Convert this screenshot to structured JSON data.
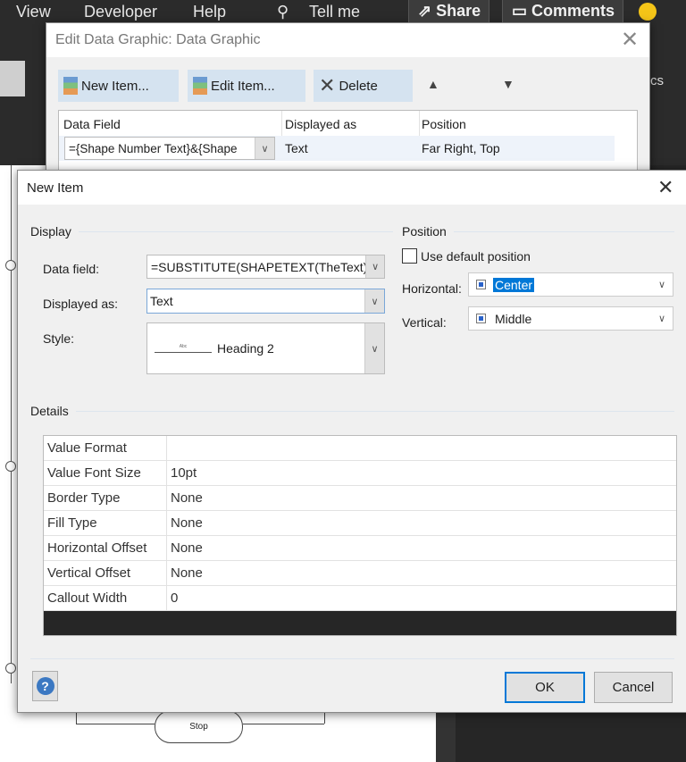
{
  "app_menu": {
    "items": [
      "View",
      "Developer",
      "Help"
    ],
    "tell_me": "Tell me",
    "share": "Share",
    "comments": "Comments",
    "ribbon_fragment": "cs"
  },
  "edit_dialog": {
    "title": "Edit Data Graphic: Data Graphic",
    "new_item": "New Item...",
    "edit_item": "Edit Item...",
    "delete": "Delete",
    "columns": [
      "Data Field",
      "Displayed as",
      "Position"
    ],
    "rows": [
      {
        "data_field": "={Shape Number Text}&{Shape",
        "displayed_as": "Text",
        "position": "Far Right, Top"
      }
    ]
  },
  "new_item": {
    "title": "New Item",
    "display": {
      "label": "Display",
      "data_field_label": "Data field:",
      "data_field_value": "=SUBSTITUTE(SHAPETEXT(TheText),C",
      "displayed_as_label": "Displayed as:",
      "displayed_as_value": "Text",
      "style_label": "Style:",
      "style_preview": "Abc",
      "style_value": "Heading 2"
    },
    "position": {
      "label": "Position",
      "use_default": "Use default position",
      "use_default_checked": false,
      "horizontal_label": "Horizontal:",
      "horizontal_value": "Center",
      "vertical_label": "Vertical:",
      "vertical_value": "Middle"
    },
    "details": {
      "label": "Details",
      "rows": [
        {
          "key": "Value Format",
          "value": ""
        },
        {
          "key": "Value Font Size",
          "value": "10pt"
        },
        {
          "key": "Border Type",
          "value": "None"
        },
        {
          "key": "Fill Type",
          "value": "None"
        },
        {
          "key": "Horizontal Offset",
          "value": "None"
        },
        {
          "key": "Vertical Offset",
          "value": "None"
        },
        {
          "key": "Callout Width",
          "value": "0"
        }
      ]
    },
    "ok": "OK",
    "cancel": "Cancel",
    "help_icon": "?"
  },
  "canvas": {
    "stop_label": "Stop"
  },
  "colors": {
    "accent": "#0078d7",
    "selection": "#0078d7",
    "toolbar_button": "#d5e3f0"
  }
}
